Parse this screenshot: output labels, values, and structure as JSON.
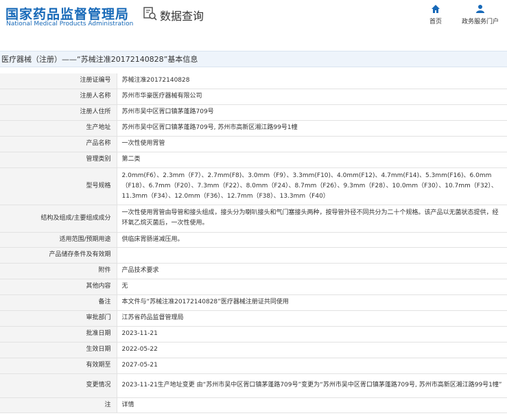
{
  "header": {
    "logo_cn": "国家药品监督管理局",
    "logo_en": "National Medical Products Administration",
    "search_title": "数据查询",
    "nav": [
      {
        "label": "首页"
      },
      {
        "label": "政务服务门户"
      }
    ]
  },
  "breadcrumb": "医疗器械（注册）——“苏械注准20172140828”基本信息",
  "rows": [
    {
      "label": "注册证编号",
      "value": "苏械注准20172140828"
    },
    {
      "label": "注册人名称",
      "value": "苏州市华豪医疗器械有限公司"
    },
    {
      "label": "注册人住所",
      "value": "苏州市吴中区胥口镇茅蓬路709号"
    },
    {
      "label": "生产地址",
      "value": "苏州市吴中区胥口镇茅蓬路709号, 苏州市高新区湘江路99号1幢"
    },
    {
      "label": "产品名称",
      "value": "一次性使用胃管"
    },
    {
      "label": "管理类别",
      "value": "第二类"
    },
    {
      "label": "型号规格",
      "value": "2.0mm(F6）、2.3mm（F7）、2.7mm(F8)、3.0mm（F9）、3.3mm(F10)、4.0mm(F12)、4.7mm(F14)、5.3mm(F16)、6.0mm（F18）、6.7mm（F20）、7.3mm（F22）、8.0mm（F24）、8.7mm（F26）、9.3mm（F28）、10.0mm（F30）、10.7mm（F32）、11.3mm（F34）、12.0mm（F36）、12.7mm（F38）、13.3mm（F40）"
    },
    {
      "label": "结构及组成/主要组成成分",
      "value": "一次性使用胃管由导管和接头组成，接头分为喇叭接头和气门塞接头两种，按导管外径不同共分为二十个规格。该产品以无菌状态提供，经环氧乙烷灭菌后，一次性使用。"
    },
    {
      "label": "适用范围/预期用途",
      "value": "供临床胃肠道减压用。"
    },
    {
      "label": "产品储存条件及有效期",
      "value": ""
    },
    {
      "label": "附件",
      "value": "产品技术要求"
    },
    {
      "label": "其他内容",
      "value": "无"
    },
    {
      "label": "备注",
      "value": "本文件与“苏械注准20172140828”医疗器械注册证共同使用"
    },
    {
      "label": "审批部门",
      "value": "江苏省药品监督管理局"
    },
    {
      "label": "批准日期",
      "value": "2023-11-21"
    },
    {
      "label": "生效日期",
      "value": "2022-05-22"
    },
    {
      "label": "有效期至",
      "value": "2027-05-21"
    },
    {
      "label": "变更情况",
      "value": "2023-11-21生产地址变更 由“苏州市吴中区胥口镇茅蓬路709号”变更为“苏州市吴中区胥口镇茅蓬路709号, 苏州市高新区湘江路99号1幢”"
    },
    {
      "label": "注",
      "value": "详情"
    }
  ]
}
